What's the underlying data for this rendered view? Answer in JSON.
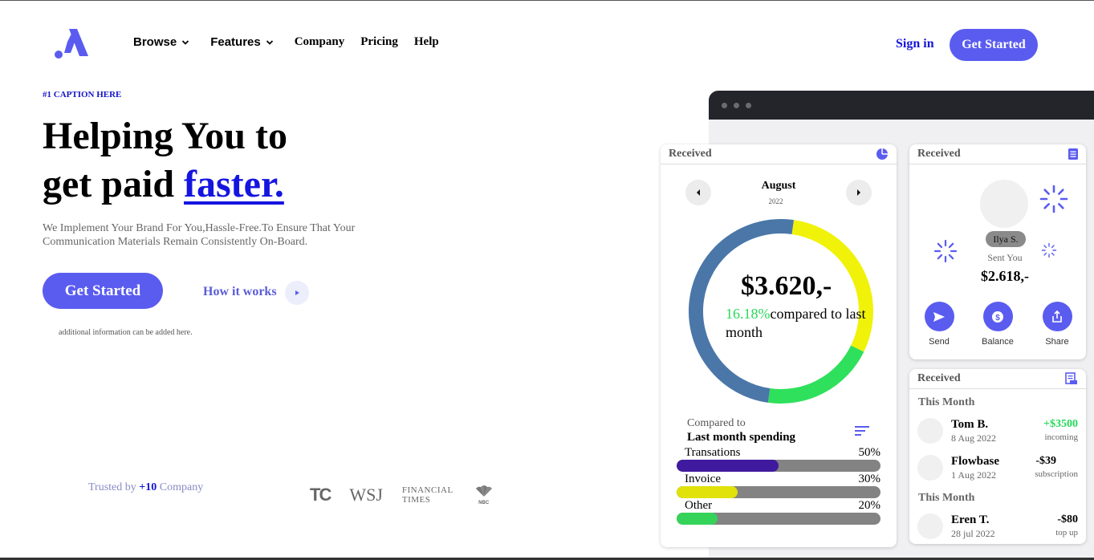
{
  "nav": {
    "items": [
      {
        "label": "Browse",
        "has_dropdown": true
      },
      {
        "label": "Features",
        "has_dropdown": true
      },
      {
        "label": "Company",
        "has_dropdown": false
      },
      {
        "label": "Pricing",
        "has_dropdown": false
      },
      {
        "label": "Help",
        "has_dropdown": false
      }
    ],
    "sign_in": "Sign in",
    "cta": "Get Started"
  },
  "hero": {
    "caption": "#1 CAPTION HERE",
    "headline_line1": "Helping You to",
    "headline_line2_prefix": "get paid ",
    "headline_accent": "faster.",
    "description": "We Implement Your Brand For You,Hassle-Free.To Ensure That Your Communication Materials Remain Consistently On-Board.",
    "cta": "Get Started",
    "secondary_link": "How it works",
    "additional_info": "additional information can be added here."
  },
  "trusted": {
    "prefix": "Trusted by ",
    "count": "+10",
    "suffix": " Company",
    "brands": [
      "TC",
      "WSJ",
      "FINANCIAL",
      "TIMES",
      "NBC"
    ]
  },
  "colors": {
    "accent": "#5a5cf0",
    "link": "#1515d8",
    "positive": "#27d858",
    "donut_blue": "#4a77a8",
    "donut_yellow": "#f0f20a",
    "donut_green": "#2fe05c"
  },
  "dashboard": {
    "received_card": {
      "title": "Received",
      "month": "August",
      "year": "2022",
      "amount": "$3.620,-",
      "change_pct": "16.18%",
      "change_text": "compared to last month",
      "donut_segments": [
        {
          "color": "#f0f20a",
          "fraction": 0.3
        },
        {
          "color": "#2fe05c",
          "fraction": 0.2
        },
        {
          "color": "#4a77a8",
          "fraction": 0.5
        }
      ],
      "compare_label": "Compared to",
      "compare_title": "Last month spending",
      "breakdown": [
        {
          "label": "Transations",
          "pct_text": "50%",
          "fraction": 0.5,
          "color": "#3f1a9e"
        },
        {
          "label": "Invoice",
          "pct_text": "30%",
          "fraction": 0.3,
          "color": "#e0e20a"
        },
        {
          "label": "Other",
          "pct_text": "20%",
          "fraction": 0.2,
          "color": "#35d35a"
        }
      ]
    },
    "sent_card": {
      "title": "Received",
      "name": "Ilya S.",
      "sent_label": "Sent You",
      "amount": "$2.618,-",
      "actions": [
        "Send",
        "Balance",
        "Share"
      ]
    },
    "tx_card": {
      "title": "Received",
      "section1": "This Month",
      "section2": "This Month",
      "transactions": [
        {
          "name": "Tom B.",
          "date": "8 Aug 2022",
          "amount": "+$3500",
          "type": "incoming"
        },
        {
          "name": "Flowbase",
          "date": "1 Aug 2022",
          "amount": "-$39",
          "type": "subscription"
        },
        {
          "name": "Eren T.",
          "date": "28 jul 2022",
          "amount": "-$80",
          "type": "top up"
        }
      ]
    }
  }
}
